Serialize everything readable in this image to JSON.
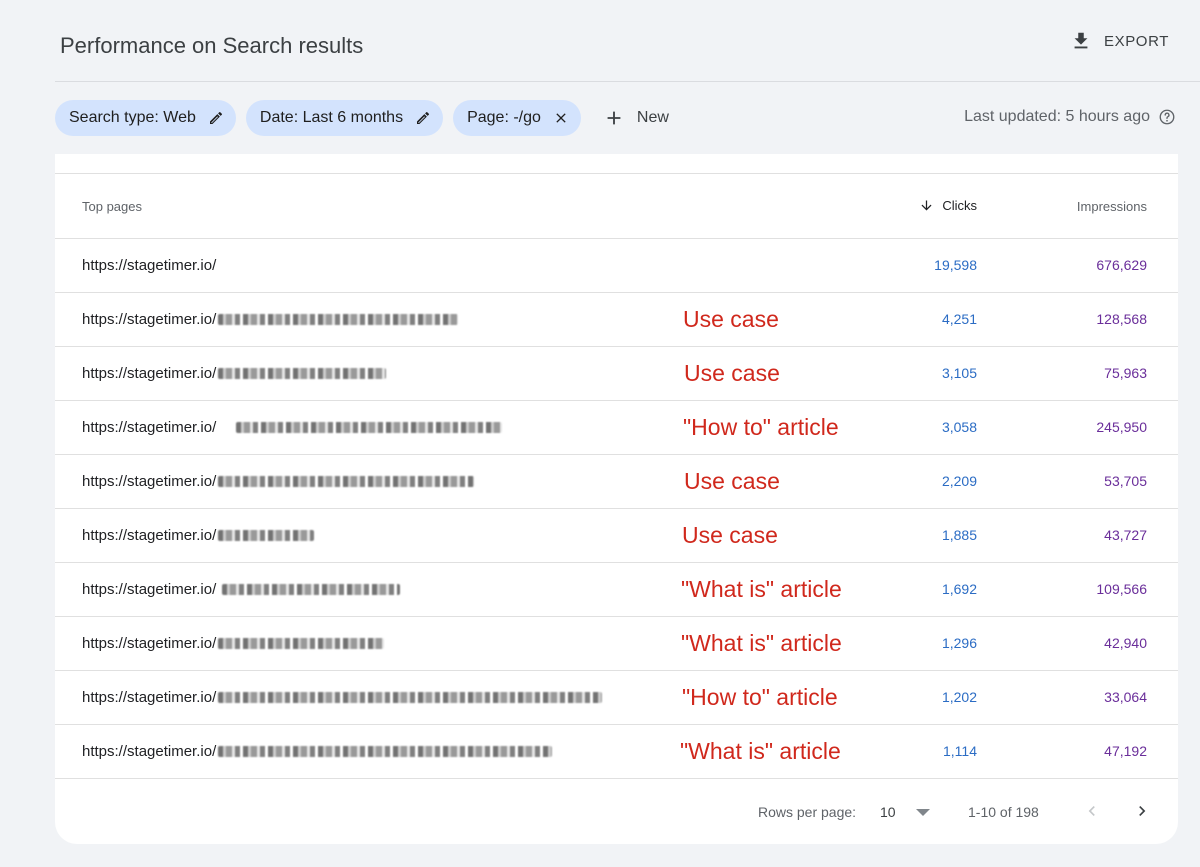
{
  "header": {
    "title": "Performance on Search results",
    "export_label": "EXPORT"
  },
  "filters": {
    "chips": [
      {
        "label": "Search type: Web",
        "icon": "pencil-icon"
      },
      {
        "label": "Date: Last 6 months",
        "icon": "pencil-icon"
      },
      {
        "label": "Page: -/go",
        "icon": "close-icon"
      }
    ],
    "new_label": "New",
    "last_updated": "Last updated: 5 hours ago"
  },
  "table": {
    "headers": {
      "pages": "Top pages",
      "clicks": "Clicks",
      "impressions": "Impressions"
    },
    "rows": [
      {
        "url": "https://stagetimer.io/",
        "annotation": "",
        "clicks": "19,598",
        "impressions": "676,629"
      },
      {
        "url": "https://stagetimer.io/",
        "annotation": "Use case",
        "clicks": "4,251",
        "impressions": "128,568"
      },
      {
        "url": "https://stagetimer.io/",
        "annotation": "Use case",
        "clicks": "3,105",
        "impressions": "75,963"
      },
      {
        "url": "https://stagetimer.io/",
        "annotation": "\"How to\" article",
        "clicks": "3,058",
        "impressions": "245,950"
      },
      {
        "url": "https://stagetimer.io/",
        "annotation": "Use case",
        "clicks": "2,209",
        "impressions": "53,705"
      },
      {
        "url": "https://stagetimer.io/",
        "annotation": "Use case",
        "clicks": "1,885",
        "impressions": "43,727"
      },
      {
        "url": "https://stagetimer.io/",
        "annotation": "\"What is\" article",
        "clicks": "1,692",
        "impressions": "109,566"
      },
      {
        "url": "https://stagetimer.io/",
        "annotation": "\"What is\" article",
        "clicks": "1,296",
        "impressions": "42,940"
      },
      {
        "url": "https://stagetimer.io/",
        "annotation": "\"How to\" article",
        "clicks": "1,202",
        "impressions": "33,064"
      },
      {
        "url": "https://stagetimer.io/",
        "annotation": "\"What is\" article",
        "clicks": "1,114",
        "impressions": "47,192"
      }
    ]
  },
  "pagination": {
    "rows_per_page_label": "Rows per page:",
    "rows_per_page_value": "10",
    "range": "1-10 of 198"
  },
  "colors": {
    "chip_bg": "#d3e3fd",
    "clicks": "#2b6cc4",
    "impressions": "#6a2e9a",
    "annotation": "#d0281c"
  }
}
